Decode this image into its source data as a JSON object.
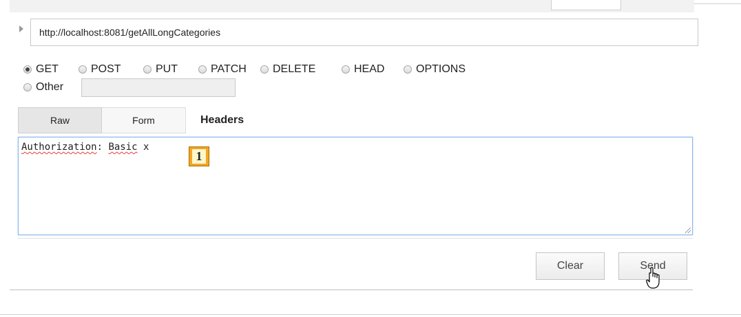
{
  "request": {
    "url": "http://localhost:8081/getAllLongCategories"
  },
  "methods": [
    {
      "label": "GET",
      "selected": true
    },
    {
      "label": "POST",
      "selected": false
    },
    {
      "label": "PUT",
      "selected": false
    },
    {
      "label": "PATCH",
      "selected": false
    },
    {
      "label": "DELETE",
      "selected": false
    },
    {
      "label": "HEAD",
      "selected": false
    },
    {
      "label": "OPTIONS",
      "selected": false
    },
    {
      "label": "Other",
      "selected": false
    }
  ],
  "other_method_value": "",
  "header_tabs": {
    "raw": "Raw",
    "form": "Form",
    "title": "Headers"
  },
  "headers_text": {
    "key": "Authorization",
    "separator": ": ",
    "scheme": "Basic",
    "value": " x"
  },
  "annotation_badge": "1",
  "actions": {
    "clear": "Clear",
    "send": "Send"
  },
  "icons": {
    "expand": "triangle-right-icon",
    "cursor": "hand-pointer-icon",
    "resize": "resize-grip-icon"
  },
  "colors": {
    "focus_border": "#8cb8e8",
    "badge": "#f5a623",
    "spellcheck": "#e53b3b"
  }
}
